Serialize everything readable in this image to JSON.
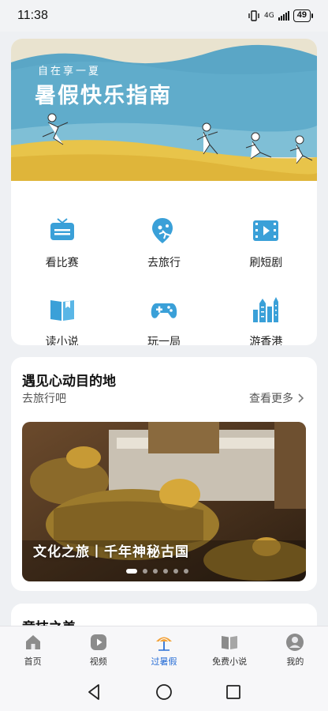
{
  "status": {
    "time": "11:38",
    "network": "4G",
    "battery": "49"
  },
  "banner": {
    "subtitle": "自在享一夏",
    "title": "暑假快乐指南"
  },
  "quick_grid": [
    {
      "label": "看比赛",
      "icon": "tv-icon"
    },
    {
      "label": "去旅行",
      "icon": "travel-pin-icon"
    },
    {
      "label": "刷短剧",
      "icon": "film-icon"
    },
    {
      "label": "读小说",
      "icon": "book-icon"
    },
    {
      "label": "玩一局",
      "icon": "gamepad-icon"
    },
    {
      "label": "游香港",
      "icon": "city-skyline-icon"
    }
  ],
  "destination": {
    "title": "遇见心动目的地",
    "subtitle": "去旅行吧",
    "more": "查看更多",
    "carousel_caption": "文化之旅丨千年神秘古国",
    "carousel_total": 6,
    "carousel_active": 1
  },
  "next_section": {
    "title": "竞技之美"
  },
  "tabs": [
    {
      "label": "首页",
      "icon": "home-icon"
    },
    {
      "label": "视频",
      "icon": "video-play-icon"
    },
    {
      "label": "过暑假",
      "icon": "beach-umbrella-icon",
      "active": true
    },
    {
      "label": "免费小说",
      "icon": "book-icon"
    },
    {
      "label": "我的",
      "icon": "profile-icon"
    }
  ],
  "colors": {
    "accent": "#2a6fd6",
    "icon_blue": "#3aa0d8",
    "sky": "#5aa6c6",
    "sand": "#e8c44a"
  }
}
